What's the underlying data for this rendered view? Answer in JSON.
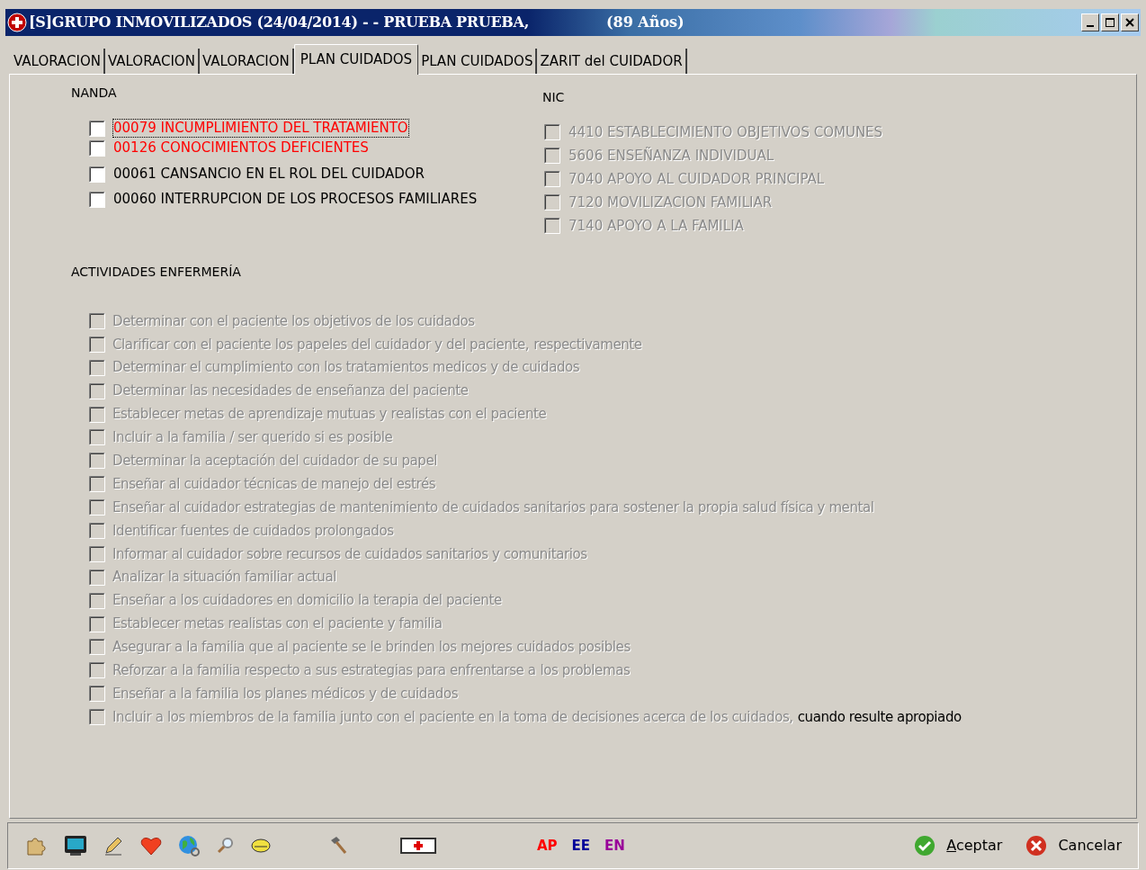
{
  "window": {
    "title": "[S]GRUPO INMOVILIZADOS (24/04/2014) -  - PRUEBA PRUEBA,",
    "age": "(89 Años)"
  },
  "tabs": [
    {
      "label": "VALORACION",
      "selected": false
    },
    {
      "label": "VALORACION",
      "selected": false
    },
    {
      "label": "VALORACION",
      "selected": false
    },
    {
      "label": "PLAN CUIDADOS",
      "selected": true
    },
    {
      "label": "PLAN CUIDADOS",
      "selected": false
    },
    {
      "label": "ZARIT del CUIDADOR",
      "selected": false
    }
  ],
  "nanda": {
    "heading": "NANDA",
    "items": [
      {
        "label": "00079 INCUMPLIMIENTO DEL TRATAMIENTO",
        "checked": false,
        "color": "#ff0000",
        "focused": true
      },
      {
        "label": "00126 CONOCIMIENTOS DEFICIENTES",
        "checked": false,
        "color": "#ff0000",
        "focused": false
      },
      {
        "label": "00061 CANSANCIO EN EL ROL DEL CUIDADOR",
        "checked": false,
        "color": "#000000",
        "focused": false
      },
      {
        "label": "00060 INTERRUPCION DE LOS PROCESOS FAMILIARES",
        "checked": false,
        "color": "#000000",
        "focused": false
      }
    ]
  },
  "nic": {
    "heading": "NIC",
    "items": [
      {
        "label": "4410 ESTABLECIMIENTO OBJETIVOS COMUNES",
        "checked": false,
        "disabled": true
      },
      {
        "label": "5606 ENSEÑANZA INDIVIDUAL",
        "checked": false,
        "disabled": true
      },
      {
        "label": "7040 APOYO AL CUIDADOR PRINCIPAL",
        "checked": false,
        "disabled": true
      },
      {
        "label": "7120 MOVILIZACION FAMILIAR",
        "checked": false,
        "disabled": true
      },
      {
        "label": "7140 APOYO A LA FAMILIA",
        "checked": false,
        "disabled": true
      }
    ]
  },
  "activities": {
    "heading": "ACTIVIDADES ENFERMERÍA",
    "items": [
      {
        "checked": false,
        "segments": [
          {
            "text": "Determinar con el paciente los objetivos de los cuidados",
            "disabled": true
          }
        ]
      },
      {
        "checked": false,
        "segments": [
          {
            "text": "Clarificar con el paciente los papeles del cuidador y del paciente,",
            "disabled": true
          },
          {
            "text": "respectivamente",
            "disabled": true
          }
        ]
      },
      {
        "checked": false,
        "segments": [
          {
            "text": "Determinar el cumplimiento con los tratamientos medicos y de cuidados",
            "disabled": true
          }
        ]
      },
      {
        "checked": false,
        "segments": [
          {
            "text": "Determinar las necesidades de enseñanza del paciente",
            "disabled": true
          }
        ]
      },
      {
        "checked": false,
        "segments": [
          {
            "text": "Establecer metas de aprendizaje mutuas y realistas con el paciente",
            "disabled": true
          }
        ]
      },
      {
        "checked": false,
        "segments": [
          {
            "text": "Incluir a la familia / ser querido si es posible",
            "disabled": true
          }
        ]
      },
      {
        "checked": false,
        "segments": [
          {
            "text": "Determinar la aceptación del cuidador de su papel",
            "disabled": true
          }
        ]
      },
      {
        "checked": false,
        "segments": [
          {
            "text": "Enseñar al cuidador técnicas de manejo del estrés",
            "disabled": true
          }
        ]
      },
      {
        "checked": false,
        "segments": [
          {
            "text": "Enseñar al cuidador estrategias de mantenimiento de cuidados sanitarios para",
            "disabled": true
          },
          {
            "text": "sostener la propia salud física y mental",
            "disabled": true
          }
        ]
      },
      {
        "checked": false,
        "segments": [
          {
            "text": "Identificar fuentes de cuidados prolongados",
            "disabled": true
          }
        ]
      },
      {
        "checked": false,
        "segments": [
          {
            "text": "Informar al cuidador sobre recursos de cuidados sanitarios y comunitarios",
            "disabled": true
          }
        ]
      },
      {
        "checked": false,
        "segments": [
          {
            "text": "Analizar la situación familiar actual",
            "disabled": true
          }
        ]
      },
      {
        "checked": false,
        "segments": [
          {
            "text": "Enseñar a los cuidadores en domicilio la terapia del paciente",
            "disabled": true
          }
        ]
      },
      {
        "checked": false,
        "segments": [
          {
            "text": "Establecer metas realistas con el paciente y familia",
            "disabled": true
          }
        ]
      },
      {
        "checked": false,
        "segments": [
          {
            "text": "Asegurar a la familia que al paciente se le brinden los mejores",
            "disabled": true
          },
          {
            "text": "cuidados posibles",
            "disabled": true
          }
        ]
      },
      {
        "checked": false,
        "segments": [
          {
            "text": "Reforzar a la familia respecto a sus estrategias para enfrentarse a",
            "disabled": true
          },
          {
            "text": "los problemas",
            "disabled": true
          }
        ]
      },
      {
        "checked": false,
        "segments": [
          {
            "text": "Enseñar a la familia los planes médicos y de cuidados",
            "disabled": true
          }
        ]
      },
      {
        "checked": false,
        "segments": [
          {
            "text": "Incluir a los miembros de la familia junto con el paciente en la toma de",
            "disabled": true
          },
          {
            "text": "decisiones acerca de los cuidados,",
            "disabled": true
          },
          {
            "text": "cuando resulte apropiado",
            "disabled": false
          }
        ]
      }
    ]
  },
  "toolbar": {
    "codes": [
      {
        "label": "AP",
        "color": "#ff0000"
      },
      {
        "label": "EE",
        "color": "#000099"
      },
      {
        "label": "EN",
        "color": "#990099"
      }
    ]
  },
  "buttons": [
    {
      "kind": "accept",
      "label": "Aceptar"
    },
    {
      "kind": "cancel",
      "label": "Cancelar"
    }
  ]
}
